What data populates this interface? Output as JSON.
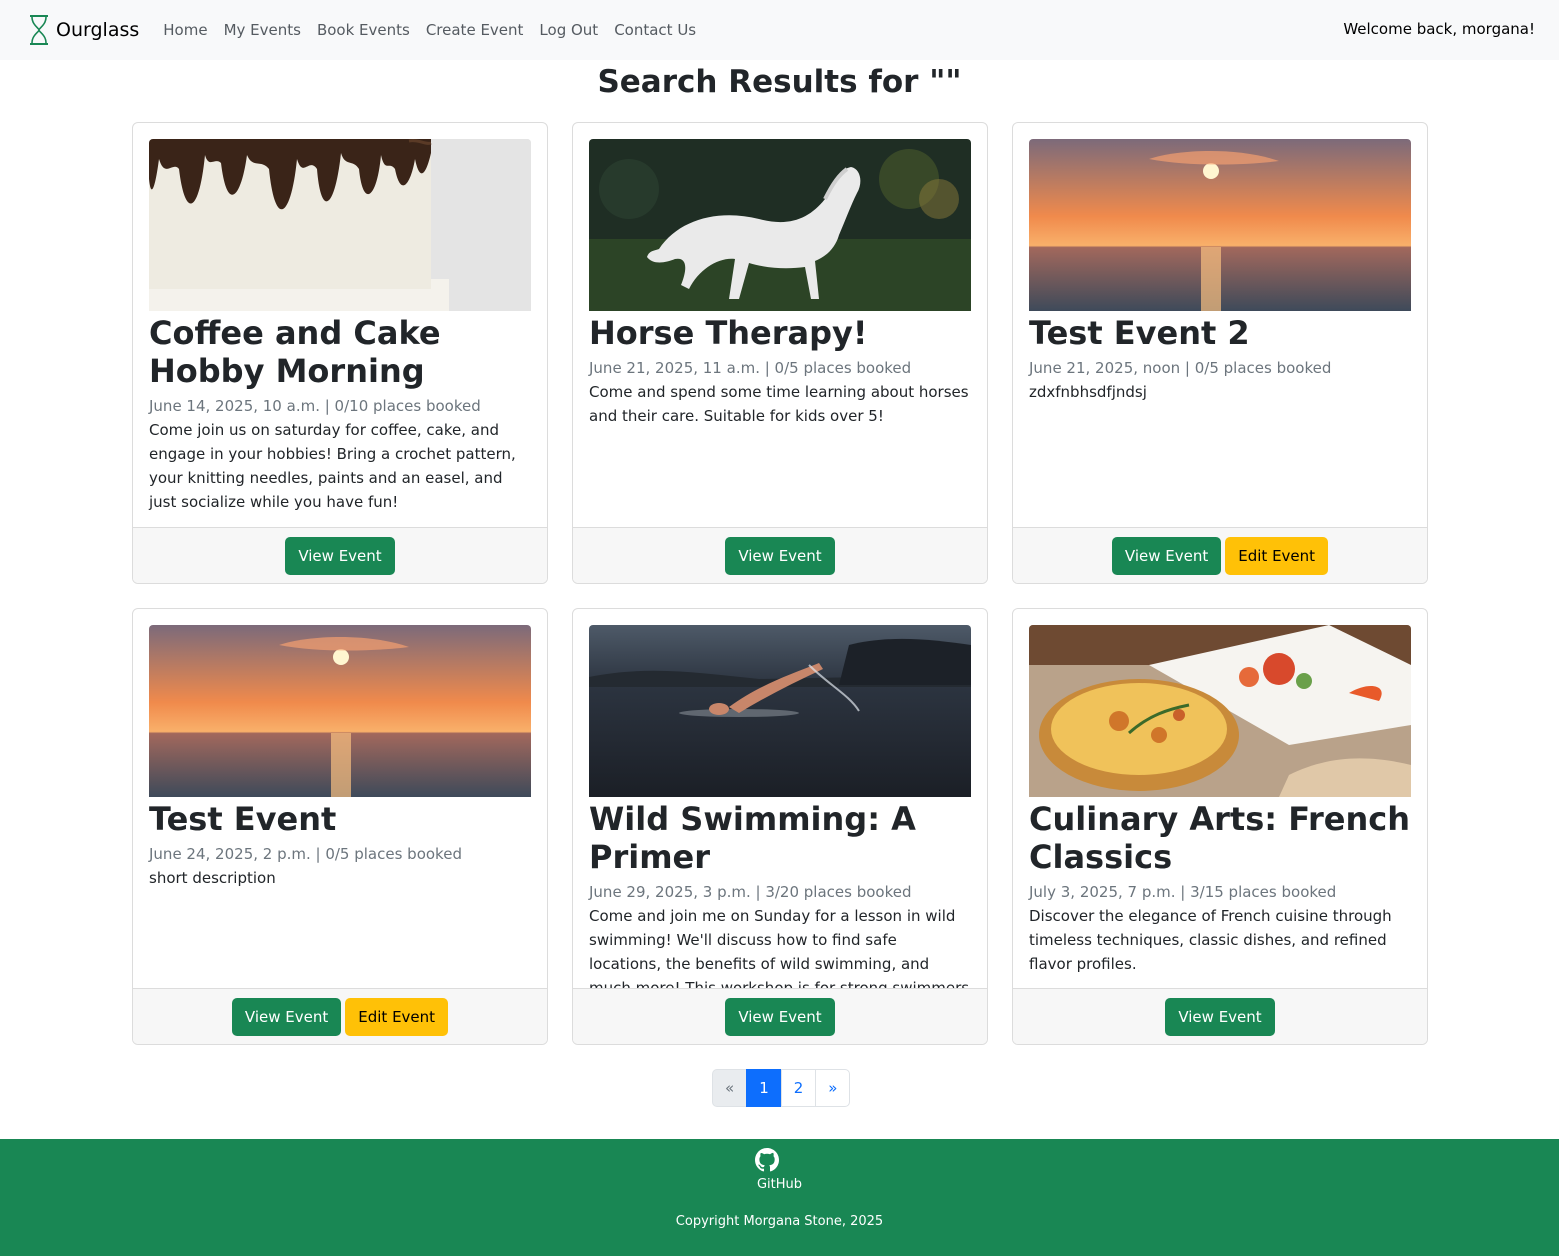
{
  "nav": {
    "brand": "Ourglass",
    "links": [
      "Home",
      "My Events",
      "Book Events",
      "Create Event",
      "Log Out",
      "Contact Us"
    ],
    "welcome": "Welcome back, morgana!"
  },
  "page": {
    "title": "Search Results for \"\""
  },
  "events": [
    {
      "title": "Coffee and Cake Hobby Morning",
      "meta": "June 14, 2025, 10 a.m. | 0/10 places booked",
      "description": "Come join us on saturday for coffee, cake, and engage in your hobbies! Bring a crochet pattern, your knitting needles, paints and an easel, and just socialize while you have fun!",
      "image": "drip-cake-photo",
      "view_label": "View Event"
    },
    {
      "title": "Horse Therapy!",
      "meta": "June 21, 2025, 11 a.m. | 0/5 places booked",
      "description": "Come and spend some time learning about horses and their care. Suitable for kids over 5!",
      "image": "white-horse-photo",
      "view_label": "View Event"
    },
    {
      "title": "Test Event 2",
      "meta": "June 21, 2025, noon | 0/5 places booked",
      "description": "zdxfnbhsdfjndsj",
      "image": "sunset-sea-photo",
      "view_label": "View Event",
      "edit_label": "Edit Event"
    },
    {
      "title": "Test Event",
      "meta": "June 24, 2025, 2 p.m. | 0/5 places booked",
      "description": "short description",
      "image": "sunset-sea-photo",
      "view_label": "View Event",
      "edit_label": "Edit Event"
    },
    {
      "title": "Wild Swimming: A Primer",
      "meta": "June 29, 2025, 3 p.m. | 3/20 places booked",
      "description": "Come and join me on Sunday for a lesson in wild swimming! We'll discuss how to find safe locations, the benefits of wild swimming, and much more! This workshop is for strong swimmers only.",
      "image": "lake-swimmer-photo",
      "view_label": "View Event"
    },
    {
      "title": "Culinary Arts: French Classics",
      "meta": "July 3, 2025, 7 p.m. | 3/15 places booked",
      "description": "Discover the elegance of French cuisine through timeless techniques, classic dishes, and refined flavor profiles.",
      "image": "quiche-photo",
      "view_label": "View Event"
    }
  ],
  "pagination": {
    "prev": "«",
    "pages": [
      "1",
      "2"
    ],
    "next": "»",
    "current_page": 1
  },
  "footer": {
    "github_label": "GitHub",
    "copyright": "Copyright Morgana Stone, 2025"
  },
  "colors": {
    "primary_green": "#198754",
    "warning_yellow": "#ffc107",
    "link_blue": "#0d6efd",
    "navbar_bg": "#f8f9fa"
  }
}
